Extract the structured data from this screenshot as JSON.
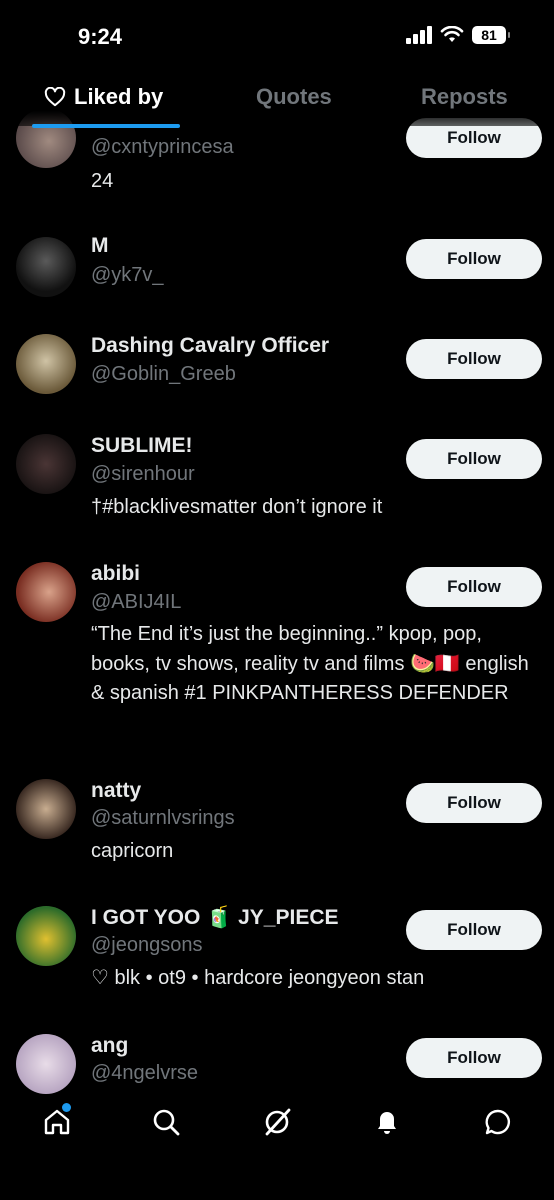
{
  "status_bar": {
    "time": "9:24",
    "battery": "81"
  },
  "tabs": [
    {
      "label": "Liked by",
      "active": true,
      "icon": "heart-outline-icon"
    },
    {
      "label": "Quotes",
      "active": false
    },
    {
      "label": "Reposts",
      "active": false
    }
  ],
  "users": [
    {
      "name": "",
      "handle": "@cxntyprincesa",
      "bio": "24",
      "follow_label": "Follow",
      "avatar_colors": [
        "#5a4a4a",
        "#a08a80"
      ]
    },
    {
      "name": "M",
      "handle": "@yk7v_",
      "bio": "",
      "follow_label": "Follow",
      "avatar_colors": [
        "#111111",
        "#5a5a5a"
      ]
    },
    {
      "name": "Dashing Cavalry Officer",
      "handle": "@Goblin_Greeb",
      "bio": "",
      "follow_label": "Follow",
      "avatar_colors": [
        "#6b5a3a",
        "#cfc3a5"
      ]
    },
    {
      "name": "SUBLIME!",
      "handle": "@sirenhour",
      "bio": "†#blacklivesmatter don’t ignore it",
      "follow_label": "Follow",
      "avatar_colors": [
        "#1a1414",
        "#4a3535"
      ]
    },
    {
      "name": "abibi",
      "handle": "@ABIJ4IL",
      "bio": "“The End it’s just the beginning..” kpop, pop, books, tv shows, reality tv and films 🍉🇵🇪 english & spanish #1 PINKPANTHERESS DEFENDER",
      "follow_label": "Follow",
      "avatar_colors": [
        "#7a2e22",
        "#d9a28a"
      ]
    },
    {
      "name": "natty",
      "handle": "@saturnlvsrings",
      "bio": "capricorn",
      "follow_label": "Follow",
      "avatar_colors": [
        "#3a2a22",
        "#c8ad90"
      ]
    },
    {
      "name": "I GOT YOO 🧃 JY_PIECE",
      "handle": "@jeongsons",
      "bio": "♡ blk • ot9 • hardcore jeongyeon stan",
      "follow_label": "Follow",
      "avatar_colors": [
        "#2c6b2a",
        "#e0c030"
      ]
    },
    {
      "name": "ang",
      "handle": "@4ngelvrse",
      "bio": "",
      "follow_label": "Follow",
      "avatar_colors": [
        "#b8a6c2",
        "#e8dce8"
      ]
    }
  ],
  "bottom_nav": [
    {
      "icon": "home-icon",
      "has_notification_dot": true
    },
    {
      "icon": "search-icon"
    },
    {
      "icon": "grok-icon"
    },
    {
      "icon": "bell-icon"
    },
    {
      "icon": "chat-bubble-icon"
    }
  ]
}
